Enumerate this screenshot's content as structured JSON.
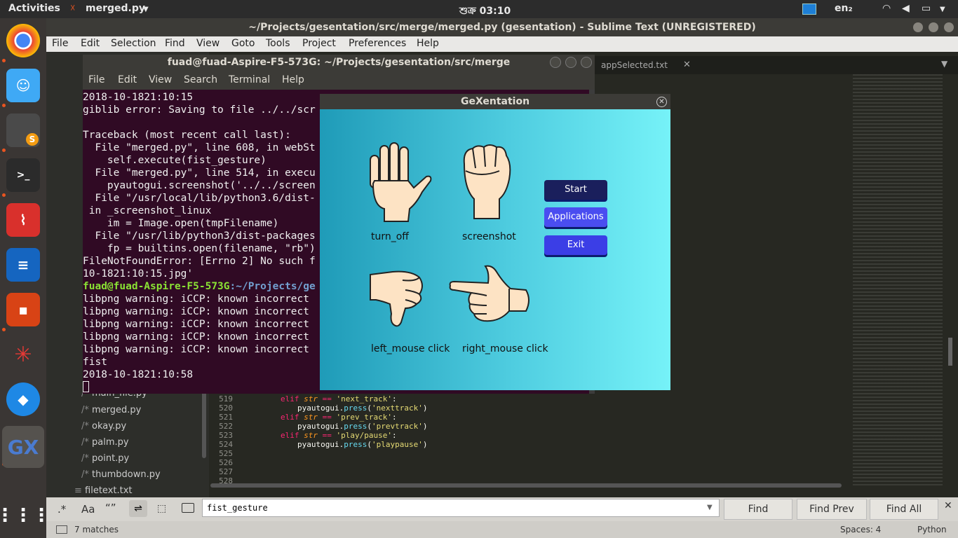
{
  "topbar": {
    "activities": "Activities",
    "app_name": "merged.py",
    "clock": "শুক্র 03:10",
    "input_lang": "en₂"
  },
  "sublime": {
    "title": "~/Projects/gesentation/src/merge/merged.py (gesentation) - Sublime Text (UNREGISTERED)",
    "menu": [
      "File",
      "Edit",
      "Selection",
      "Find",
      "View",
      "Goto",
      "Tools",
      "Project",
      "Preferences",
      "Help"
    ],
    "tab_label": "appSelected.txt",
    "sidebar_files": [
      "main_file.py",
      "merged.py",
      "okay.py",
      "palm.py",
      "point.py",
      "thumbdown.py",
      "filetext.txt"
    ],
    "line_numbers": [
      "519",
      "520",
      "521",
      "522",
      "523",
      "524",
      "525",
      "526",
      "527",
      "528"
    ],
    "code": {
      "l519_kw": "elif",
      "l519_var": "str",
      "l519_op": " == ",
      "l519_str": "'next_track'",
      "l519_end": ":",
      "l520_obj": "pyautogui",
      "l520_fn": "press",
      "l520_str": "'nexttrack'",
      "l521_kw": "elif",
      "l521_var": "str",
      "l521_op": " == ",
      "l521_str": "'prev_track'",
      "l521_end": ":",
      "l522_obj": "pyautogui",
      "l522_fn": "press",
      "l522_str": "'prevtrack'",
      "l523_kw": "elif",
      "l523_var": "str",
      "l523_op": " == ",
      "l523_str": "'play/pause'",
      "l523_end": ":",
      "l524_obj": "pyautogui",
      "l524_fn": "press",
      "l524_str": "'playpause'"
    },
    "find": {
      "value": "fist_gesture",
      "find_label": "Find",
      "find_prev_label": "Find Prev",
      "find_all_label": "Find All",
      "regex_label": ".*",
      "case_label": "Aa",
      "word_label": "“”"
    },
    "status": {
      "matches": "7 matches",
      "spaces": "Spaces: 4",
      "syntax": "Python"
    }
  },
  "terminal": {
    "title": "fuad@fuad-Aspire-F5-573G: ~/Projects/gesentation/src/merge",
    "menu": [
      "File",
      "Edit",
      "View",
      "Search",
      "Terminal",
      "Help"
    ],
    "lines": [
      "2018-10-1821:10:15",
      "giblib error: Saving to file ../../scr",
      "",
      "Traceback (most recent call last):",
      "  File \"merged.py\", line 608, in webSt",
      "    self.execute(fist_gesture)",
      "  File \"merged.py\", line 514, in execu",
      "    pyautogui.screenshot('../../screen",
      "  File \"/usr/local/lib/python3.6/dist-",
      " in _screenshot_linux",
      "    im = Image.open(tmpFilename)",
      "  File \"/usr/lib/python3/dist-packages",
      "    fp = builtins.open(filename, \"rb\")",
      "FileNotFoundError: [Errno 2] No such f",
      "10-1821:10:15.jpg'"
    ],
    "prompt_user": "fuad@fuad-Aspire-F5-573G",
    "prompt_path": ":~/Projects/ge",
    "lines_after": [
      "libpng warning: iCCP: known incorrect",
      "libpng warning: iCCP: known incorrect",
      "libpng warning: iCCP: known incorrect",
      "libpng warning: iCCP: known incorrect",
      "libpng warning: iCCP: known incorrect",
      "fist",
      "2018-10-1821:10:58"
    ]
  },
  "gexentation": {
    "title": "GeXentation",
    "gestures": [
      "turn_off",
      "screenshot",
      "left_mouse click",
      "right_mouse click"
    ],
    "buttons": {
      "start": "Start",
      "applications": "Applications",
      "exit": "Exit"
    },
    "colors": {
      "start": "#1a1f5c",
      "applications": "#4a4df0",
      "exit": "#3b3ee6"
    }
  },
  "dock_icons": [
    "chrome-icon",
    "finder-icon",
    "sublime-icon",
    "terminal-icon",
    "acrobat-icon",
    "writer-icon",
    "impress-icon",
    "spider-icon",
    "shark-icon",
    "gexentation-icon",
    "app-grid-icon"
  ]
}
